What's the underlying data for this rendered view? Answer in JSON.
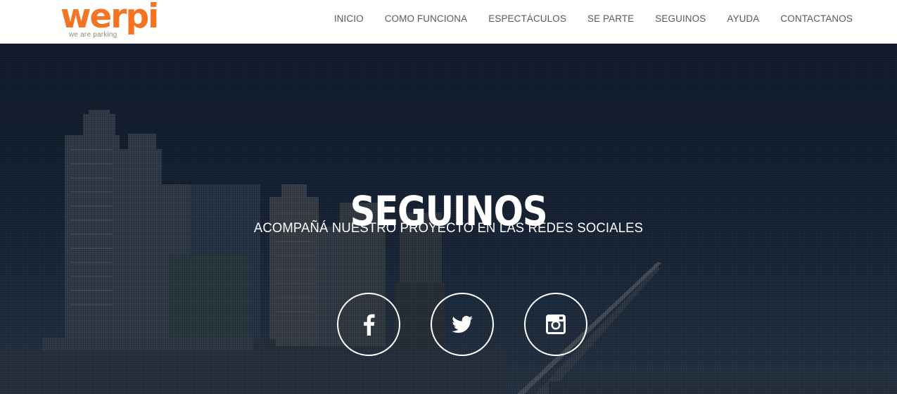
{
  "header": {
    "logo": {
      "word": "werpi",
      "tagline": "we are parking"
    },
    "nav": [
      {
        "label": "INICIO"
      },
      {
        "label": "COMO FUNCIONA"
      },
      {
        "label": "ESPECTÁCULOS"
      },
      {
        "label": "SE PARTE"
      },
      {
        "label": "SEGUINOS"
      },
      {
        "label": "AYUDA"
      },
      {
        "label": "CONTACTANOS"
      }
    ]
  },
  "hero": {
    "title": "SEGUINOS",
    "subtitle": "ACOMPAÑÁ NUESTRO PROYECTO EN LAS REDES SOCIALES",
    "socials": [
      {
        "icon": "facebook-icon"
      },
      {
        "icon": "twitter-icon"
      },
      {
        "icon": "instagram-icon"
      }
    ]
  },
  "colors": {
    "brand": "#f47422",
    "nav_text": "#5a5a5a",
    "hero_text": "#ffffff"
  }
}
